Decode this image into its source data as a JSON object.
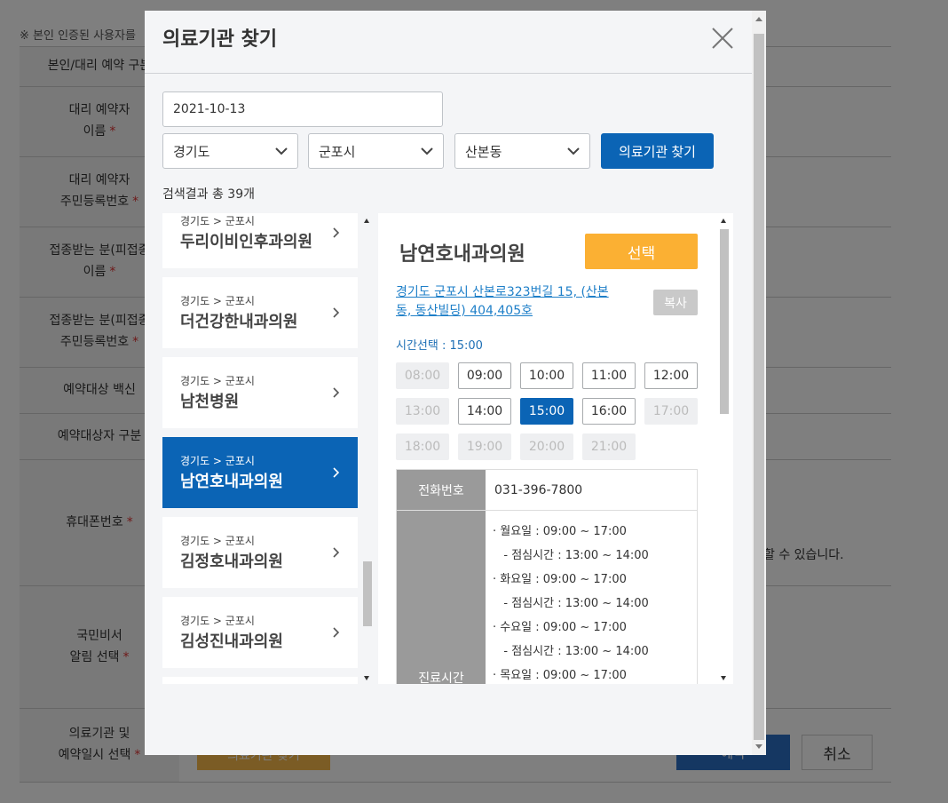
{
  "background": {
    "notice": "※ 본인 인증된 사용자를",
    "rows": [
      {
        "label": "본인/대리 예약 구분",
        "required": false
      },
      {
        "label": "대리 예약자\n이름",
        "required": true
      },
      {
        "label": "대리 예약자\n주민등록번호",
        "required": true
      },
      {
        "label": "접종받는 분(피접종\n이름",
        "required": true
      },
      {
        "label": "접종받는 분(피접종\n주민등록번호",
        "required": true
      },
      {
        "label": "예약대상 백신",
        "required": false
      },
      {
        "label": "예약대상자 구분",
        "required": false
      },
      {
        "label": "휴대폰번호",
        "required": true
      },
      {
        "label": "국민비서\n알림 선택",
        "required": true
      },
      {
        "label": "의료기관 및\n예약일시 선택",
        "required": true
      }
    ],
    "phone_note": "할 수 있습니다.",
    "find_button": "의료기관 찾기",
    "reserve_button": "예약",
    "cancel_button": "취소",
    "required_mark": "*"
  },
  "modal": {
    "title": "의료기관 찾기",
    "date_value": "2021-10-13",
    "province": "경기도",
    "city": "군포시",
    "district": "산본동",
    "search_button": "의료기관 찾기",
    "result_count": "검색결과 총 39개",
    "hospitals": [
      {
        "region": "경기도 > 군포시",
        "name": "두리이비인후과의원",
        "active": false
      },
      {
        "region": "경기도 > 군포시",
        "name": "더건강한내과의원",
        "active": false
      },
      {
        "region": "경기도 > 군포시",
        "name": "남천병원",
        "active": false
      },
      {
        "region": "경기도 > 군포시",
        "name": "남연호내과의원",
        "active": true
      },
      {
        "region": "경기도 > 군포시",
        "name": "김정호내과의원",
        "active": false
      },
      {
        "region": "경기도 > 군포시",
        "name": "김성진내과의원",
        "active": false
      }
    ],
    "detail": {
      "name": "남연호내과의원",
      "select_button": "선택",
      "address": "경기도 군포시 산본로323번길 15, (산본동, 동산빌딩) 404,405호",
      "copy_button": "복사",
      "time_label": "시간선택 : 15:00",
      "slots": [
        {
          "time": "08:00",
          "state": "disabled"
        },
        {
          "time": "09:00",
          "state": "available"
        },
        {
          "time": "10:00",
          "state": "available"
        },
        {
          "time": "11:00",
          "state": "available"
        },
        {
          "time": "12:00",
          "state": "available"
        },
        {
          "time": "13:00",
          "state": "disabled"
        },
        {
          "time": "14:00",
          "state": "available"
        },
        {
          "time": "15:00",
          "state": "selected"
        },
        {
          "time": "16:00",
          "state": "available"
        },
        {
          "time": "17:00",
          "state": "disabled"
        },
        {
          "time": "18:00",
          "state": "disabled"
        },
        {
          "time": "19:00",
          "state": "disabled"
        },
        {
          "time": "20:00",
          "state": "disabled"
        },
        {
          "time": "21:00",
          "state": "disabled"
        }
      ],
      "phone_label": "전화번호",
      "phone": "031-396-7800",
      "hours_label": "진료시간",
      "hours": [
        "· 월요일 : 09:00 ~ 17:00",
        "   - 점심시간 : 13:00 ~ 14:00",
        "· 화요일 : 09:00 ~ 17:00",
        "   - 점심시간 : 13:00 ~ 14:00",
        "· 수요일 : 09:00 ~ 17:00",
        "   - 점심시간 : 13:00 ~ 14:00",
        "· 목요일 : 09:00 ~ 17:00"
      ]
    }
  },
  "colors": {
    "primary": "#0b64b5",
    "accent": "#fbb033",
    "link": "#1e7fc8"
  }
}
